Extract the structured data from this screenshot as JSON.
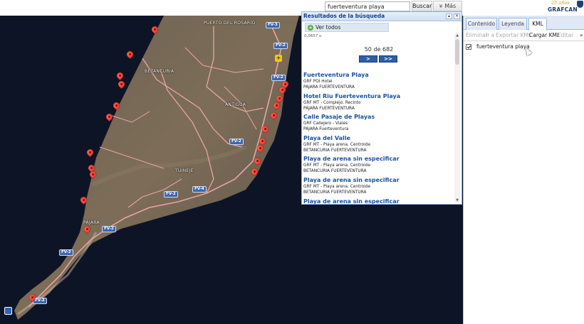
{
  "search": {
    "value": "fuerteventura playa",
    "button": "Buscar",
    "more": "Más"
  },
  "logo": {
    "years": "25 años",
    "brand": "GRAFCAN"
  },
  "map": {
    "places": [
      "PUERTO DEL ROSARIO",
      "BETANCURIA",
      "ANTIGUA",
      "TUINEJE",
      "PÁJARA"
    ],
    "roads": [
      "FV-3",
      "FV-2",
      "FV-2",
      "FV-2",
      "FV-4",
      "FV-2",
      "FV-2",
      "FV-2",
      "FV-2"
    ]
  },
  "results": {
    "title": "Resultados de la búsqueda",
    "view_all": "Ver todos",
    "time": "0,0657 s.",
    "pager_text": "50 de 682",
    "next": ">",
    "last": ">>",
    "items": [
      {
        "title": "Fuerteventura Playa",
        "type": "GRF POI Hotel",
        "place": "PÁJARA FUERTEVENTURA"
      },
      {
        "title": "Hotel Riu Fuerteventura Playa",
        "type": "GRF MT - Complejo. Recinto",
        "place": "PÁJARA FUERTEVENTURA"
      },
      {
        "title": "Calle Pasaje de Playas",
        "type": "GRF Callejero - Viales",
        "place": "PÁJARA Fuerteventura"
      },
      {
        "title": "Playa del Valle",
        "type": "GRF MT - Playa arena. Centroide",
        "place": "BETANCURIA FUERTEVENTURA"
      },
      {
        "title": "Playa de arena sin especificar",
        "type": "GRF MT - Playa arena. Centroide",
        "place": "BETANCURIA FUERTEVENTURA"
      },
      {
        "title": "Playa de arena sin especificar",
        "type": "GRF MT - Playa arena. Centroide",
        "place": "BETANCURIA FUERTEVENTURA"
      },
      {
        "title": "Playa de arena sin especificar",
        "type": "",
        "place": ""
      }
    ]
  },
  "side": {
    "tabs": [
      "Contenido",
      "Leyenda",
      "KML"
    ],
    "toolbar": [
      "Eliminar",
      "Ir a",
      "Exportar KML",
      "Cargar KML",
      "Editar",
      "»"
    ],
    "kml_item": "fuerteventura playa"
  }
}
